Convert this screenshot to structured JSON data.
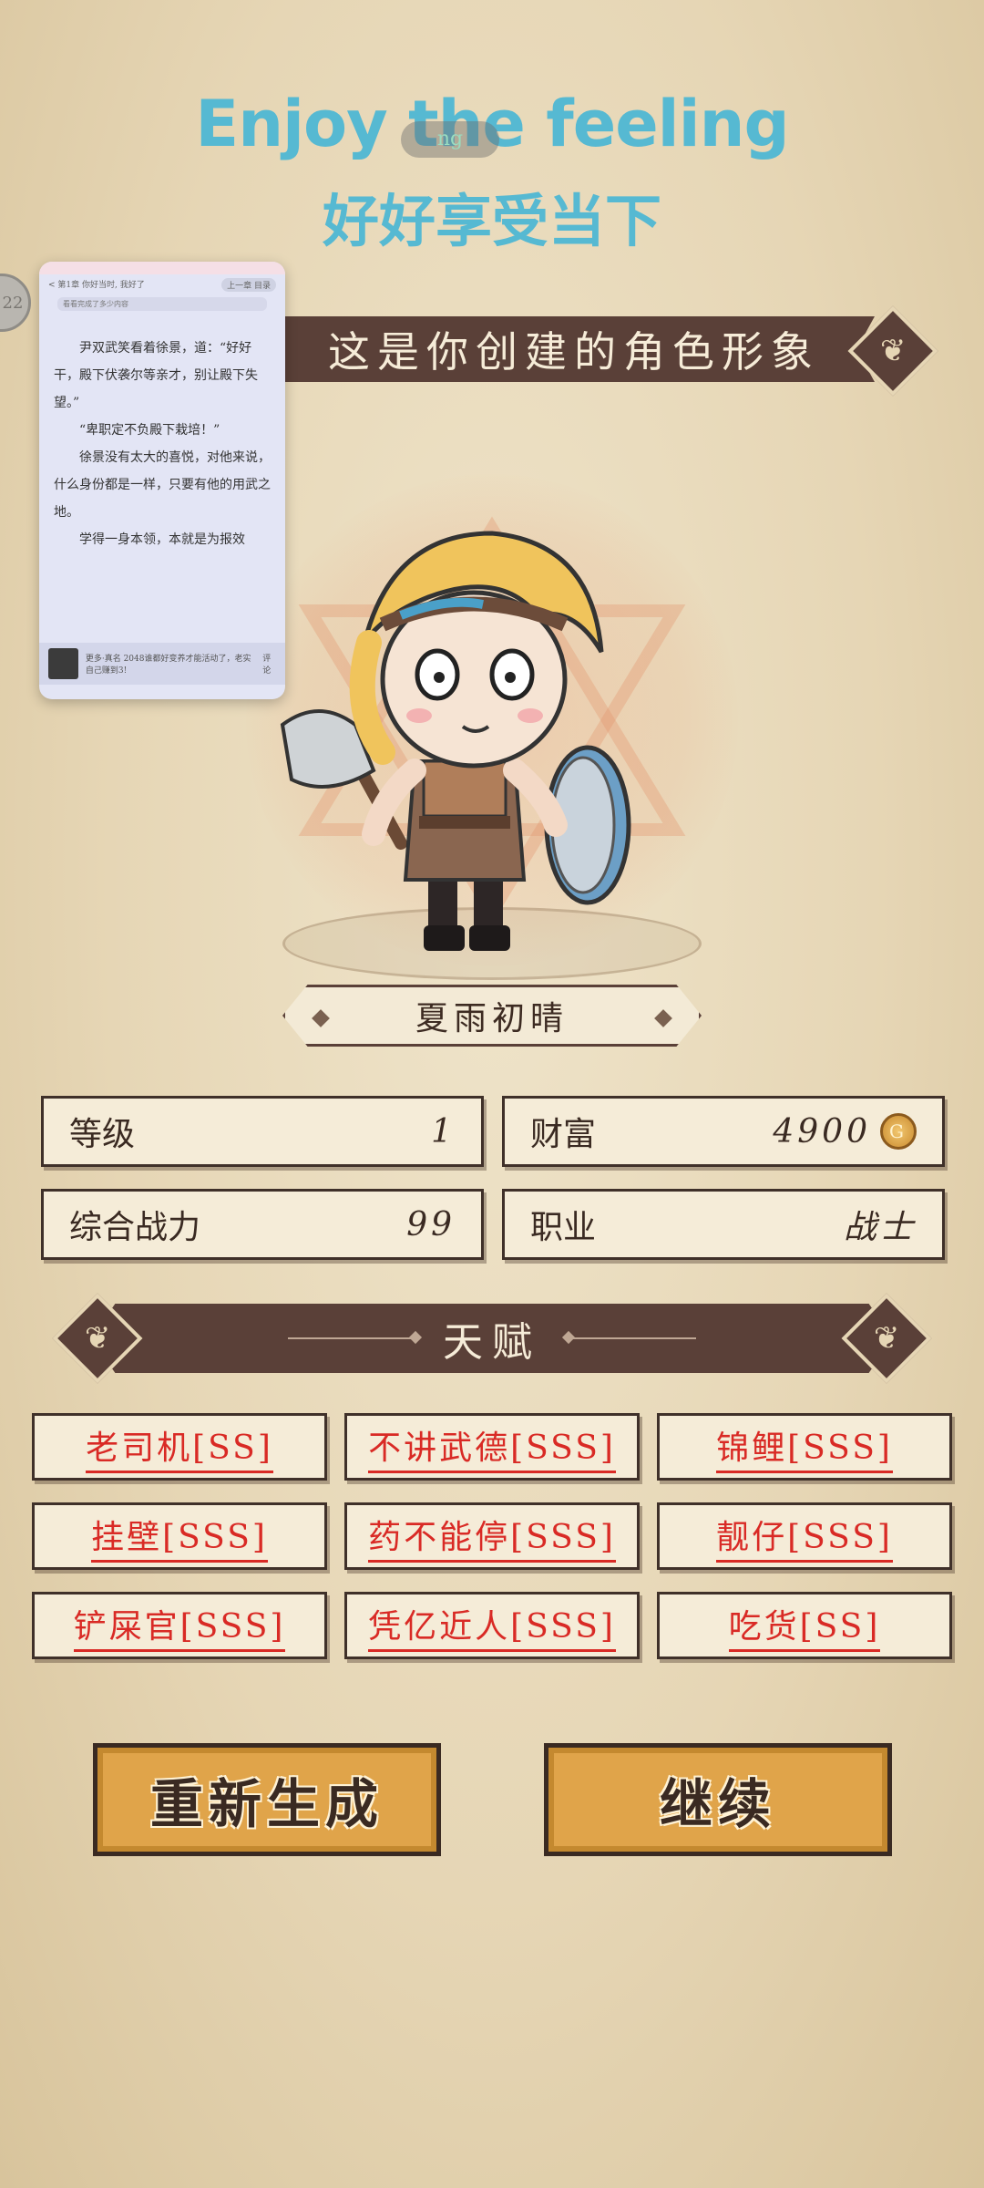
{
  "overlay": {
    "caption_en": "Enjoy the feeling",
    "caption_zh": "好好享受当下",
    "pill_text": "ng",
    "side_badge": "22"
  },
  "floating_window": {
    "header_left": "< 第1章 你好当时, 我好了",
    "header_right": "上一章 目录",
    "subheader": "看看完成了多少内容",
    "paragraphs": [
      "尹双武笑看着徐景，道：“好好干，殿下伏袭尔等亲才，别让殿下失望。”",
      "“卑职定不负殿下栽培！”",
      "徐景没有太大的喜悦，对他来说，什么身份都是一样，只要有他的用武之地。",
      "学得一身本领，本就是为报效"
    ],
    "footer_text": "更多·真名 2048谁都好变养才能活动了，老实自己赚到3!",
    "footer_action": "评论"
  },
  "banners": {
    "character": "这是你创建的角色形象",
    "talent": "天赋"
  },
  "character_name": "夏雨初晴",
  "stats": {
    "level_label": "等级",
    "level_value": "1",
    "wealth_label": "财富",
    "wealth_value": "4900",
    "power_label": "综合战力",
    "power_value": "99",
    "job_label": "职业",
    "job_value": "战士"
  },
  "talents": [
    "老司机[SS]",
    "不讲武德[SSS]",
    "锦鲤[SSS]",
    "挂壁[SSS]",
    "药不能停[SSS]",
    "靓仔[SSS]",
    "铲屎官[SSS]",
    "凭亿近人[SSS]",
    "吃货[SS]"
  ],
  "buttons": {
    "regenerate": "重新生成",
    "continue": "继续"
  },
  "colors": {
    "banner": "#5a4038",
    "button": "#e0a44a",
    "talent_text": "#d92a25",
    "caption": "#56b9d2"
  }
}
